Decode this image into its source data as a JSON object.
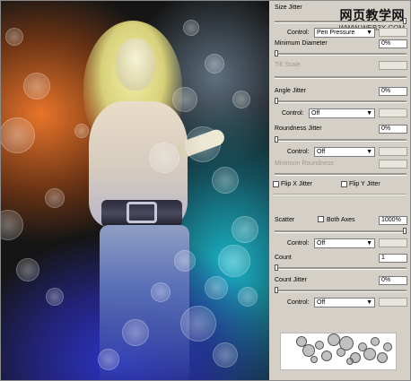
{
  "watermark": {
    "title": "网页教学网",
    "url": "WWW.WEB3X.COM"
  },
  "brush": {
    "size_jitter": {
      "label": "Size Jitter"
    },
    "size_control": {
      "label": "Control:",
      "value": "Pen Pressure"
    },
    "minimum_diameter": {
      "label": "Minimum Diameter",
      "value": "0%"
    },
    "tilt_scale": {
      "label": "Tilt Scale"
    },
    "angle_jitter": {
      "label": "Angle Jitter",
      "value": "0%"
    },
    "angle_control": {
      "label": "Control:",
      "value": "Off"
    },
    "roundness_jitter": {
      "label": "Roundness Jitter",
      "value": "0%"
    },
    "roundness_control": {
      "label": "Control:",
      "value": "Off"
    },
    "minimum_roundness": {
      "label": "Minimum Roundness"
    },
    "flip_x": {
      "label": "Flip X Jitter",
      "checked": false
    },
    "flip_y": {
      "label": "Flip Y Jitter",
      "checked": false
    },
    "scatter": {
      "label": "Scatter",
      "value": "1000%",
      "level": 1.0
    },
    "both_axes": {
      "label": "Both Axes",
      "checked": false
    },
    "scatter_control": {
      "label": "Control:",
      "value": "Off"
    },
    "count": {
      "label": "Count",
      "value": "1"
    },
    "count_jitter": {
      "label": "Count Jitter",
      "value": "0%"
    },
    "count_control": {
      "label": "Control:",
      "value": "Off"
    }
  },
  "colors": {
    "panel": "#d4d0c8",
    "photo_orange": "#e8742a",
    "photo_blue": "#2a35c8",
    "photo_cyan": "#1ab6c9"
  }
}
